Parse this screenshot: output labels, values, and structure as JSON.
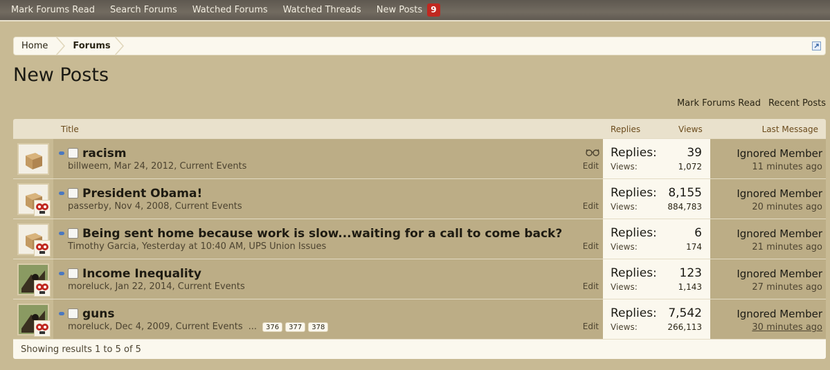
{
  "topnav": {
    "items": [
      "Mark Forums Read",
      "Search Forums",
      "Watched Forums",
      "Watched Threads",
      "New Posts"
    ],
    "new_posts_count": "9"
  },
  "breadcrumb": [
    "Home",
    "Forums"
  ],
  "page_title": "New Posts",
  "top_links": [
    "Mark Forums Read",
    "Recent Posts"
  ],
  "table": {
    "headers": {
      "title": "Title",
      "replies": "Replies",
      "views": "Views",
      "last_message": "Last Message"
    },
    "replies_label": "Replies:",
    "views_label": "Views:",
    "edit_label": "Edit",
    "rows": [
      {
        "title": "racism",
        "meta": "billweem, Mar 24, 2012, Current Events",
        "replies": "39",
        "views": "1,072",
        "last_user": "Ignored Member",
        "last_time": "11 minutes ago"
      },
      {
        "title": "President Obama!",
        "meta": "passerby, Nov 4, 2008, Current Events",
        "replies": "8,155",
        "views": "884,783",
        "last_user": "Ignored Member",
        "last_time": "20 minutes ago"
      },
      {
        "title": "Being sent home because work is slow...waiting for a call to come back?",
        "meta": "Timothy Garcia, Yesterday at 10:40 AM, UPS Union Issues",
        "replies": "6",
        "views": "174",
        "last_user": "Ignored Member",
        "last_time": "21 minutes ago"
      },
      {
        "title": "Income Inequality",
        "meta": "moreluck, Jan 22, 2014, Current Events",
        "replies": "123",
        "views": "1,143",
        "last_user": "Ignored Member",
        "last_time": "27 minutes ago"
      },
      {
        "title": "guns",
        "meta": "moreluck, Dec 4, 2009, Current Events",
        "pages_ellipsis": "...",
        "pages": [
          "376",
          "377",
          "378"
        ],
        "replies": "7,542",
        "views": "266,113",
        "last_user": "Ignored Member",
        "last_time": "30 minutes ago"
      }
    ],
    "footer": "Showing results 1 to 5 of 5"
  },
  "colors": {
    "background": "#c8ba94",
    "nav_bar": "#726b60",
    "badge": "#c02820",
    "row": "#bcad86",
    "panel": "#fbf8ee"
  }
}
